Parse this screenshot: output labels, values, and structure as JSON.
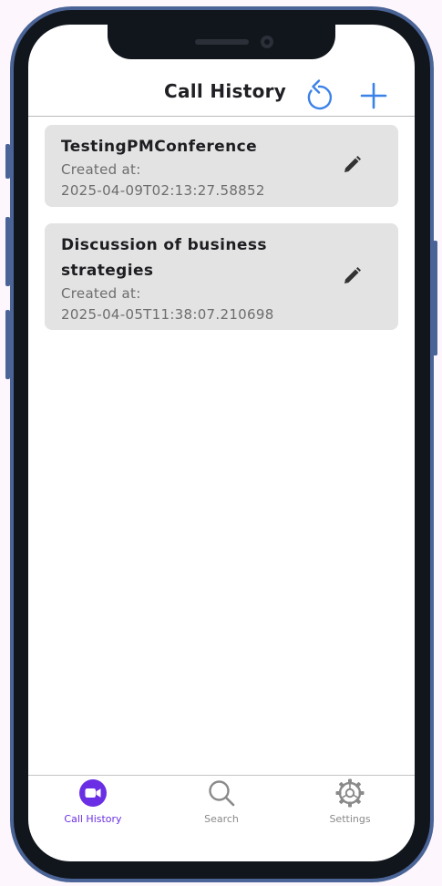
{
  "header": {
    "title": "Call History",
    "refresh_icon": "refresh-icon",
    "add_icon": "plus-icon",
    "accent": "#3b82e8"
  },
  "calls": [
    {
      "title": "TestingPMConference",
      "created_label": "Created at:",
      "created_at": "2025-04-09T02:13:27.58852"
    },
    {
      "title_line1": "Discussion of business",
      "title_line2": "strategies",
      "created_label": "Created at:",
      "created_at": "2025-04-05T11:38:07.210698"
    }
  ],
  "tabs": [
    {
      "label": "Call History",
      "icon": "video-camera-icon",
      "active": true
    },
    {
      "label": "Search",
      "icon": "search-icon",
      "active": false
    },
    {
      "label": "Settings",
      "icon": "gear-icon",
      "active": false
    }
  ],
  "colors": {
    "active_tab": "#6a2fe4",
    "card_bg": "#e3e3e3",
    "device_frame": "#4a6497"
  }
}
